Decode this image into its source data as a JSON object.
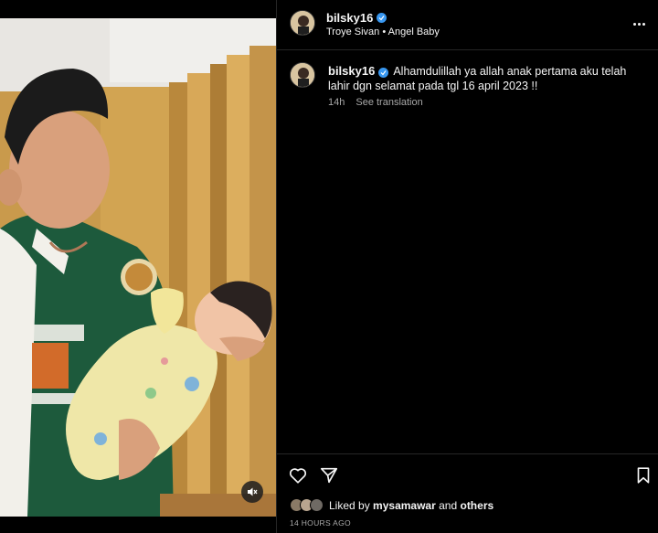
{
  "post": {
    "username": "bilsky16",
    "audio": "Troye Sivan • Angel Baby",
    "caption_user": "bilsky16",
    "caption_text": "Alhamdulillah ya allah anak pertama aku telah lahir dgn selamat pada tgl 16 april 2023 !!",
    "caption_age": "14h",
    "see_translation": "See translation",
    "liked_prefix": "Liked by",
    "liked_user": "mysamawar",
    "liked_and": "and",
    "liked_others": "others",
    "timestamp": "14 HOURS AGO"
  },
  "icons": {
    "more": "more-options-icon",
    "verified": "verified-badge-icon",
    "like": "heart-icon",
    "share": "send-icon",
    "save": "bookmark-icon",
    "mute": "mute-icon"
  },
  "colors": {
    "background": "#000000",
    "text": "#f5f5f5",
    "secondary_text": "#a8a8a8",
    "verified": "#3897f0",
    "divider": "#262626"
  }
}
